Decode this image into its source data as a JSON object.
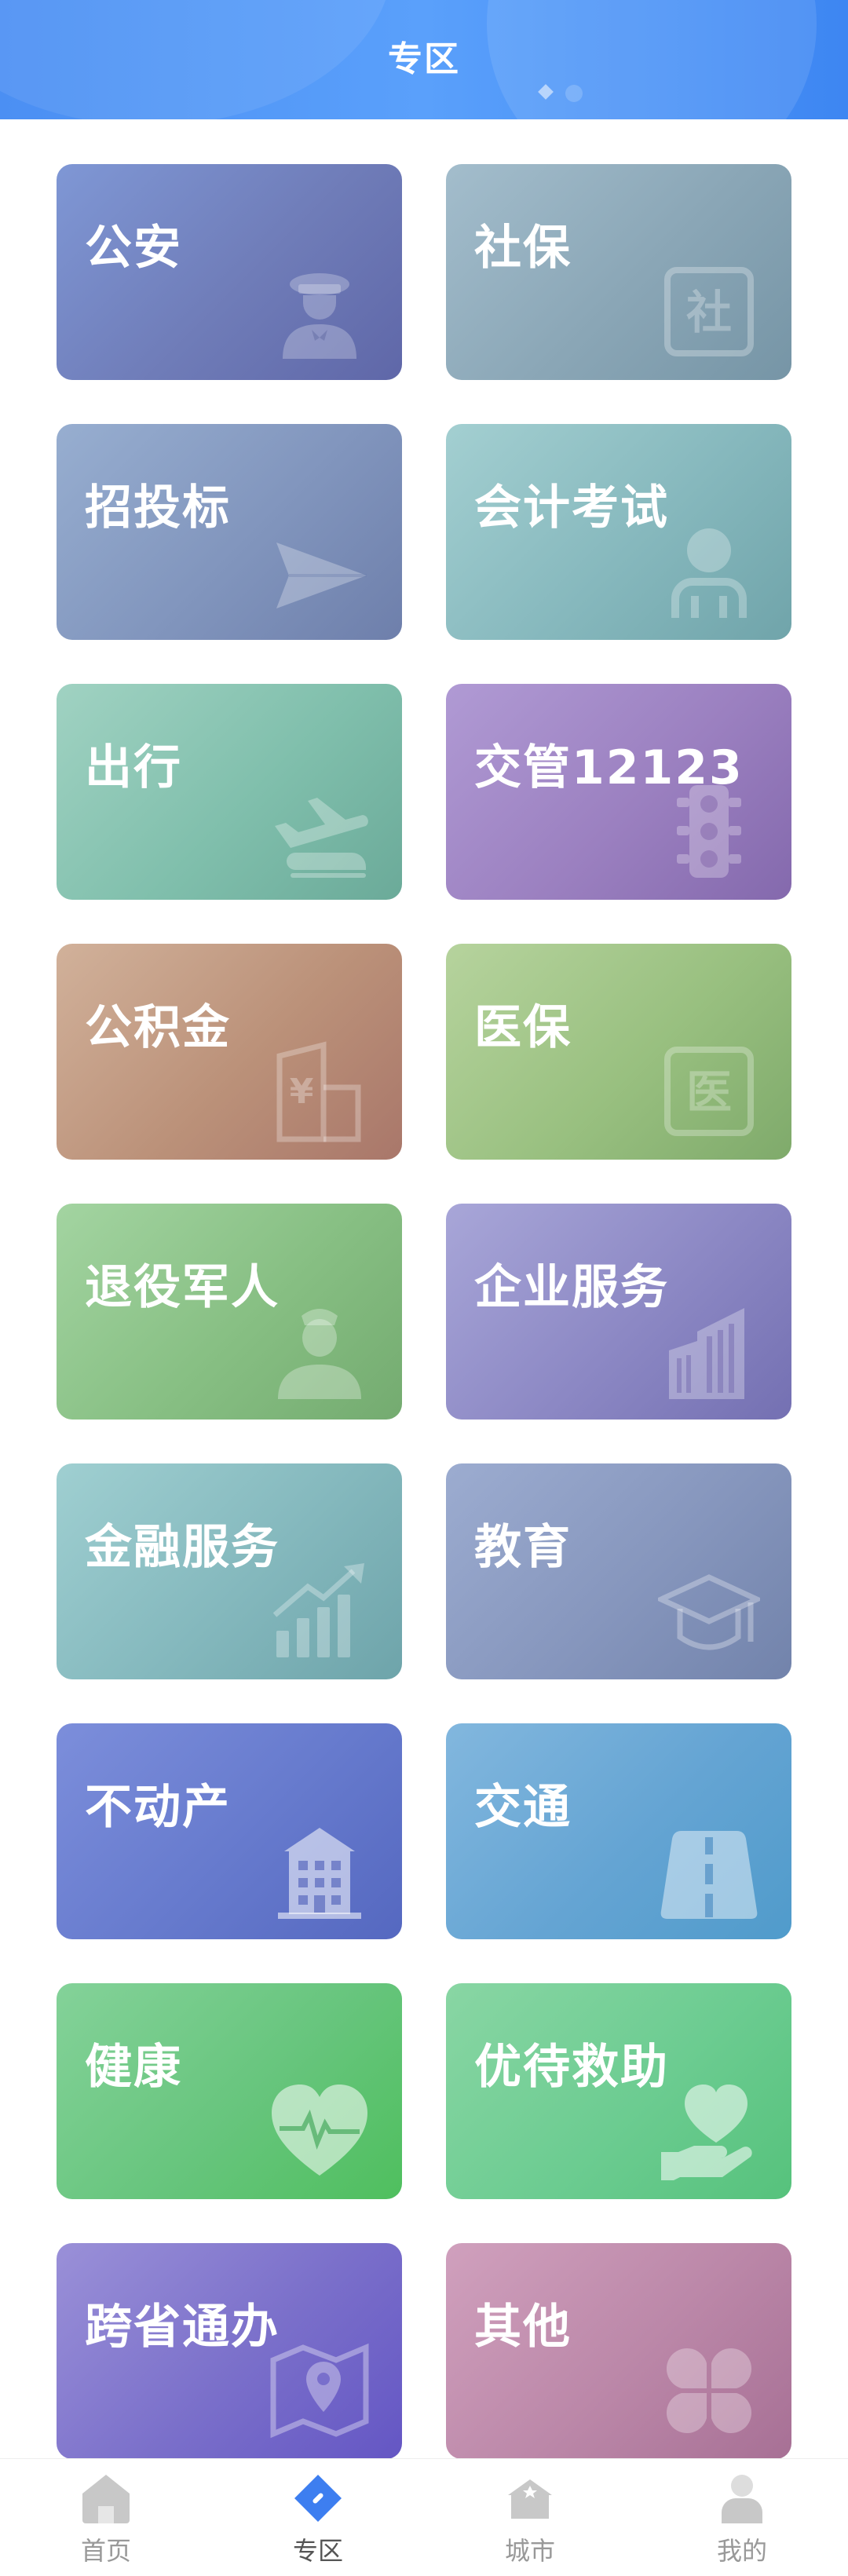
{
  "header": {
    "title": "专区"
  },
  "cards": [
    {
      "label": "公安",
      "icon": "police-icon"
    },
    {
      "label": "社保",
      "icon": "social-security-icon"
    },
    {
      "label": "招投标",
      "icon": "paper-plane-icon"
    },
    {
      "label": "会计考试",
      "icon": "person-icon"
    },
    {
      "label": "出行",
      "icon": "plane-train-icon"
    },
    {
      "label": "交管12123",
      "icon": "traffic-light-icon"
    },
    {
      "label": "公积金",
      "icon": "housing-fund-icon"
    },
    {
      "label": "医保",
      "icon": "medical-insurance-icon"
    },
    {
      "label": "退役军人",
      "icon": "veteran-icon"
    },
    {
      "label": "企业服务",
      "icon": "building-icon"
    },
    {
      "label": "金融服务",
      "icon": "chart-growth-icon"
    },
    {
      "label": "教育",
      "icon": "graduation-cap-icon"
    },
    {
      "label": "不动产",
      "icon": "real-estate-icon"
    },
    {
      "label": "交通",
      "icon": "road-icon"
    },
    {
      "label": "健康",
      "icon": "heart-pulse-icon"
    },
    {
      "label": "优待救助",
      "icon": "heart-hand-icon"
    },
    {
      "label": "跨省通办",
      "icon": "map-pin-icon"
    },
    {
      "label": "其他",
      "icon": "clover-icon"
    }
  ],
  "tabbar": {
    "items": [
      {
        "label": "首页",
        "icon": "home-icon",
        "active": false
      },
      {
        "label": "专区",
        "icon": "tag-icon",
        "active": true
      },
      {
        "label": "城市",
        "icon": "city-icon",
        "active": false
      },
      {
        "label": "我的",
        "icon": "user-icon",
        "active": false
      }
    ]
  },
  "colors": {
    "header_start": "#4b8ff3",
    "header_end": "#3d86f2",
    "tab_active": "#3d7ef0",
    "tab_inactive": "#c8c8c8"
  }
}
